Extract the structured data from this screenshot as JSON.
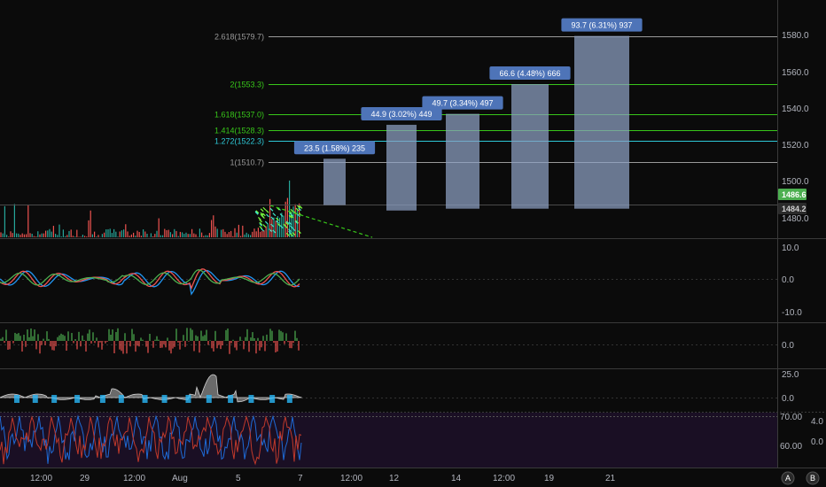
{
  "colors": {
    "background": "#0b0b0b",
    "axis_text": "#b2b5be",
    "fib_white": "#9a9a9a",
    "fib_green": "#38c71a",
    "fib_cyan": "#2ec7d6",
    "measure_fill": "#8da1c4",
    "measure_label_bg": "#4e74b8",
    "price_up": "#26a69a",
    "price_down": "#ef5350",
    "green_tag": "#4caf50",
    "dark_tag": "#2b2b2b",
    "stoch_bg": "#1a0f24"
  },
  "price_axis": {
    "ticks": [
      "1580.0",
      "1560.0",
      "1540.0",
      "1520.0",
      "1500.0",
      "1480.0"
    ],
    "last_price_tag": "1486.6",
    "secondary_tag": "1484.2"
  },
  "fib_levels": [
    {
      "ratio_label": "2.618(1579.7)",
      "price": 1579.7,
      "color": "white"
    },
    {
      "ratio_label": "2(1553.3)",
      "price": 1553.3,
      "color": "green"
    },
    {
      "ratio_label": "1.618(1537.0)",
      "price": 1537.0,
      "color": "green"
    },
    {
      "ratio_label": "1.414(1528.3)",
      "price": 1528.3,
      "color": "green"
    },
    {
      "ratio_label": "1.272(1522.3)",
      "price": 1522.3,
      "color": "cyan"
    },
    {
      "ratio_label": "1(1510.7)",
      "price": 1510.7,
      "color": "white"
    }
  ],
  "measurements": [
    {
      "label": "23.5 (1.58%) 235",
      "from": 1487.0,
      "to": 1512.4
    },
    {
      "label": "44.9 (3.02%) 449",
      "from": 1484.0,
      "to": 1531.0
    },
    {
      "label": "49.7 (3.34%) 497",
      "from": 1485.0,
      "to": 1537.0
    },
    {
      "label": "66.6 (4.48%) 666",
      "from": 1485.0,
      "to": 1553.3
    },
    {
      "label": "93.7 (6.31%) 937",
      "from": 1485.0,
      "to": 1579.7
    }
  ],
  "panes": {
    "oscillator": {
      "ticks": [
        "10.0",
        "0.0",
        "-10.0"
      ]
    },
    "histogram": {
      "ticks": [
        "0.0"
      ]
    },
    "momentum": {
      "ticks": [
        "25.0",
        "0.0"
      ]
    },
    "stochastic": {
      "ticks": [
        "70.00",
        "60.00"
      ],
      "right_ticks": [
        "4.0",
        "0.0"
      ]
    }
  },
  "time_axis": {
    "labels": [
      "12:00",
      "29",
      "12:00",
      "Aug",
      "5",
      "7",
      "12:00",
      "12",
      "14",
      "12:00",
      "19",
      "21"
    ]
  },
  "buttons": {
    "auto_scale": "A",
    "log_scale": "B"
  }
}
